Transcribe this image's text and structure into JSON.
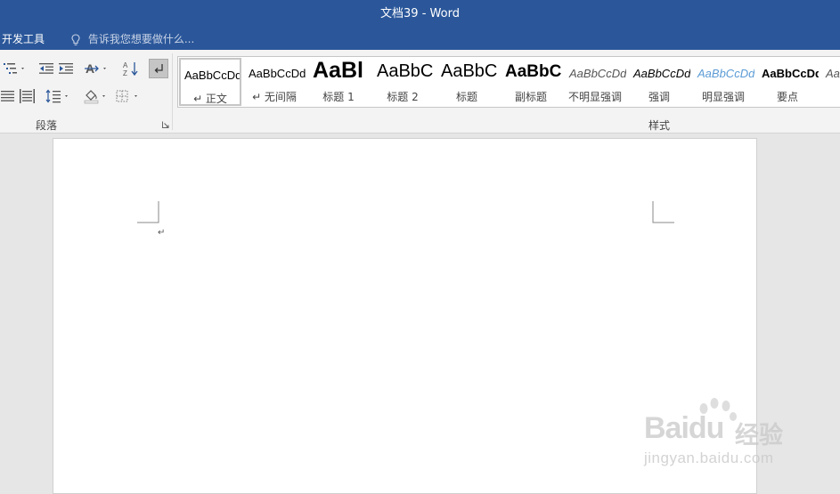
{
  "window": {
    "title": "文档39 - Word"
  },
  "tabs": {
    "developer": "开发工具"
  },
  "tell_me": {
    "placeholder": "告诉我您想要做什么..."
  },
  "ribbon": {
    "paragraph_group_label": "段落",
    "styles_group_label": "样式"
  },
  "styles": [
    {
      "preview": "AaBbCcDd",
      "name": "↵ 正文",
      "selected": true
    },
    {
      "preview": "AaBbCcDd",
      "name": "↵ 无间隔"
    },
    {
      "preview": "AaBl",
      "name": "标题 1"
    },
    {
      "preview": "AaBbC",
      "name": "标题 2"
    },
    {
      "preview": "AaBbC",
      "name": "标题"
    },
    {
      "preview": "AaBbC",
      "name": "副标题"
    },
    {
      "preview": "AaBbCcDd",
      "name": "不明显强调"
    },
    {
      "preview": "AaBbCcDd",
      "name": "强调"
    },
    {
      "preview": "AaBbCcDd",
      "name": "明显强调"
    },
    {
      "preview": "AaBbCcDd",
      "name": "要点"
    },
    {
      "preview": "Aa",
      "name": ""
    }
  ],
  "document": {
    "paragraph_mark": "↵"
  },
  "watermark": {
    "brand": "Baidu",
    "brand_cn": "经验",
    "url": "jingyan.baidu.com"
  },
  "colors": {
    "titlebar": "#2b579a",
    "ribbon": "#f3f3f3",
    "canvas": "#e6e6e6",
    "subtle_emphasis": "#5b9bd5"
  }
}
